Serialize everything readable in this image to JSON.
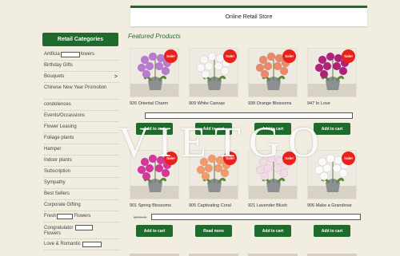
{
  "header": {
    "title": "Online Retail Store"
  },
  "sidebar": {
    "title": "Retail Categories",
    "items": [
      {
        "label": "Artificial Flowers",
        "pre": "Artificia",
        "post": "lowers"
      },
      {
        "label": "Birthday Gifts"
      },
      {
        "label": "Bouquets",
        "arrow": ">"
      },
      {
        "label": "Chinese New Year Promotion"
      },
      {
        "label": "condolences"
      },
      {
        "label": "Events/Occassions"
      },
      {
        "label": "Flower Leasing"
      },
      {
        "label": "Foliage plants"
      },
      {
        "label": "Hamper"
      },
      {
        "label": "Indoor plants"
      },
      {
        "label": "Subscription"
      },
      {
        "label": "Sympathy"
      },
      {
        "label": "Best Sellers"
      },
      {
        "label": "Corporate Gifting"
      },
      {
        "label": "Fresh Flowers",
        "pre": "Fresh",
        "post": "Flowers"
      },
      {
        "label": "Congratulatory Flowers",
        "pre": "Congratulator",
        "post": "Flowers"
      },
      {
        "label": "Love & Romantic",
        "pre": "Love & Romantic"
      }
    ]
  },
  "main": {
    "featured_title": "Featured Products",
    "row1": [
      {
        "name": "926 Oriental Charm",
        "sale": true,
        "button": "Add to cart",
        "flower": "#b97ad0"
      },
      {
        "name": "909 White Canvas",
        "sale": true,
        "button": "Add to cart",
        "flower": "#f7f7f7"
      },
      {
        "name": "938 Orange Blossoms",
        "sale": true,
        "button": "Add to cart",
        "flower": "#e98a6a"
      },
      {
        "name": "947 In Love",
        "sale": true,
        "button": "Add to cart",
        "flower": "#b0227a"
      }
    ],
    "row2": [
      {
        "name": "901 Spring Blossoms",
        "sale": true,
        "button": "Add to cart",
        "flower": "#d6359b"
      },
      {
        "name": "905 Captivating Coral",
        "sale": true,
        "button": "Read more",
        "flower": "#f19a6c"
      },
      {
        "name": "921 Lavender Blush",
        "sale": true,
        "button": "Add to cart",
        "flower": "#f3d8e6"
      },
      {
        "name": "906 Make a Grandiose",
        "sale": true,
        "button": "Add to cart",
        "flower": "#fbfbfb"
      }
    ],
    "row2_old_price": "$270.00",
    "sale_label": "Sale!"
  },
  "watermark": "VIETGO",
  "colors": {
    "brand_green": "#1f6b2b",
    "sale_red": "#e8211c",
    "page_bg": "#f1ede1"
  }
}
